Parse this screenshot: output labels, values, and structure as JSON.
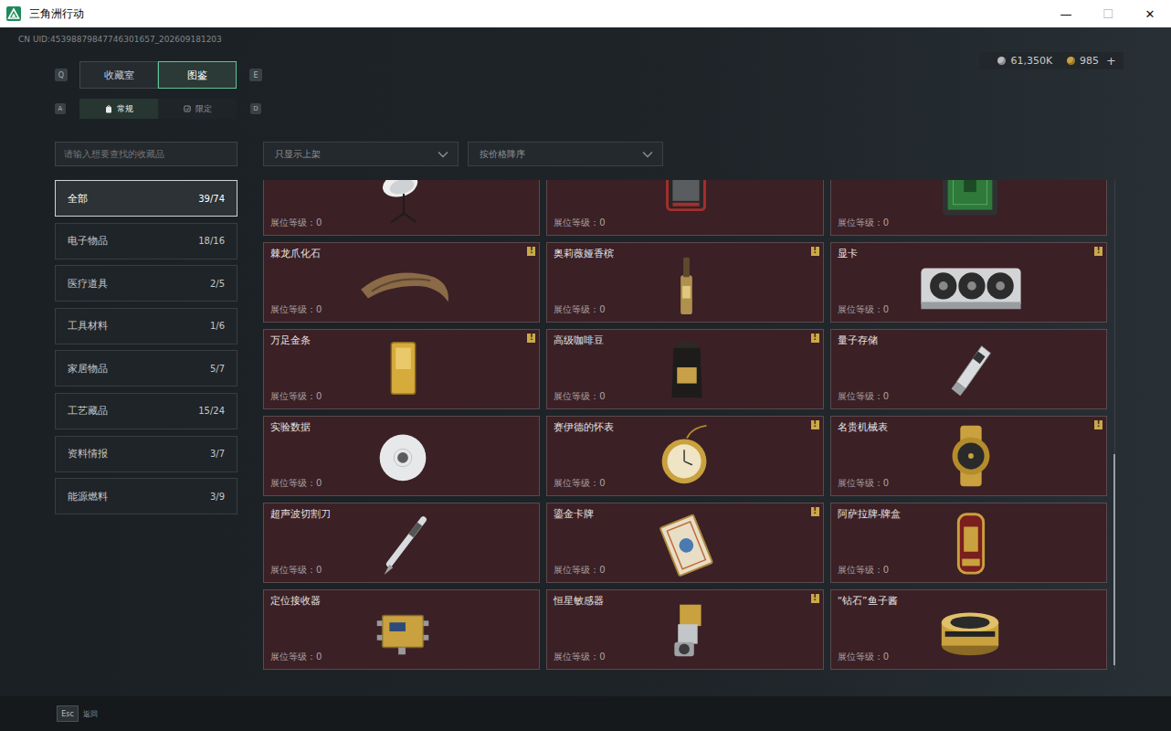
{
  "window": {
    "title": "三角洲行动",
    "controls": [
      {
        "glyph": "—",
        "disabled": false
      },
      {
        "glyph": "☐",
        "disabled": true
      },
      {
        "glyph": "✕",
        "disabled": false
      }
    ]
  },
  "uid": "CN UID:45398879847746301657_202609181203",
  "currencies": [
    {
      "amount": "61,350K",
      "color": "#b8bcc0"
    },
    {
      "amount": "985",
      "action": "+",
      "color": "#c9a13e"
    }
  ],
  "tabs": {
    "prev_key": "Q",
    "next_key": "E",
    "items": [
      {
        "label": "收藏室",
        "selected": false
      },
      {
        "label": "图鉴",
        "selected": true
      }
    ]
  },
  "subtabs": {
    "prev_key": "A",
    "next_key": "D",
    "items": [
      {
        "label": "常规",
        "selected": true
      },
      {
        "label": "限定",
        "selected": false
      }
    ]
  },
  "search": {
    "placeholder": "请输入想要查找的收藏品"
  },
  "filters": [
    {
      "label": "只显示上架"
    },
    {
      "label": "按价格降序"
    }
  ],
  "categories": [
    {
      "label": "全部",
      "count": "39/74",
      "selected": true
    },
    {
      "label": "电子物品",
      "count": "18/16",
      "selected": false
    },
    {
      "label": "医疗道具",
      "count": "2/5",
      "selected": false
    },
    {
      "label": "工具材料",
      "count": "1/6",
      "selected": false
    },
    {
      "label": "家居物品",
      "count": "5/7",
      "selected": false
    },
    {
      "label": "工艺藏品",
      "count": "15/24",
      "selected": false
    },
    {
      "label": "资料情报",
      "count": "3/7",
      "selected": false
    },
    {
      "label": "能源燃料",
      "count": "3/9",
      "selected": false
    }
  ],
  "cards": [
    {
      "level_label": "展位等级：0",
      "badge": null,
      "kind": "dish"
    },
    {
      "level_label": "展位等级：0",
      "badge": null,
      "kind": "redcase"
    },
    {
      "level_label": "展位等级：0",
      "badge": null,
      "kind": "greencase"
    },
    {
      "name": "棘龙爪化石",
      "level_label": "展位等级：0",
      "badge": "!",
      "kind": "fossil"
    },
    {
      "name": "奥莉薇娅香槟",
      "level_label": "展位等级：0",
      "badge": "!",
      "kind": "bottle"
    },
    {
      "name": "显卡",
      "level_label": "展位等级：0",
      "badge": "!",
      "kind": "gpu"
    },
    {
      "name": "万足金条",
      "level_label": "展位等级：0",
      "badge": "!",
      "kind": "goldbar"
    },
    {
      "name": "高级咖啡豆",
      "level_label": "展位等级：0",
      "badge": "!",
      "kind": "coffee"
    },
    {
      "name": "量子存储",
      "level_label": "展位等级：0",
      "badge": null,
      "kind": "usb"
    },
    {
      "name": "实验数据",
      "level_label": "展位等级：0",
      "badge": null,
      "kind": "disc"
    },
    {
      "name": "赛伊德的怀表",
      "level_label": "展位等级：0",
      "badge": "!",
      "kind": "pocketwatch"
    },
    {
      "name": "名贵机械表",
      "level_label": "展位等级：0",
      "badge": "!",
      "kind": "watch"
    },
    {
      "name": "超声波切割刀",
      "level_label": "展位等级：0",
      "badge": null,
      "kind": "knife"
    },
    {
      "name": "鎏金卡牌",
      "level_label": "展位等级：0",
      "badge": "!",
      "kind": "card"
    },
    {
      "name": "阿萨拉牌-牌盒",
      "level_label": "展位等级：0",
      "badge": null,
      "kind": "cardbox"
    },
    {
      "name": "定位接收器",
      "level_label": "展位等级：0",
      "badge": null,
      "kind": "receiver"
    },
    {
      "name": "恒星敏感器",
      "level_label": "展位等级：0",
      "badge": "!",
      "kind": "sensor"
    },
    {
      "name": "“钻石”鱼子酱",
      "level_label": "展位等级：0",
      "badge": null,
      "kind": "caviar"
    }
  ],
  "scrollbar": {
    "position": 0.56,
    "size": 0.43
  },
  "footer": {
    "key": "Esc",
    "label": "返回"
  }
}
